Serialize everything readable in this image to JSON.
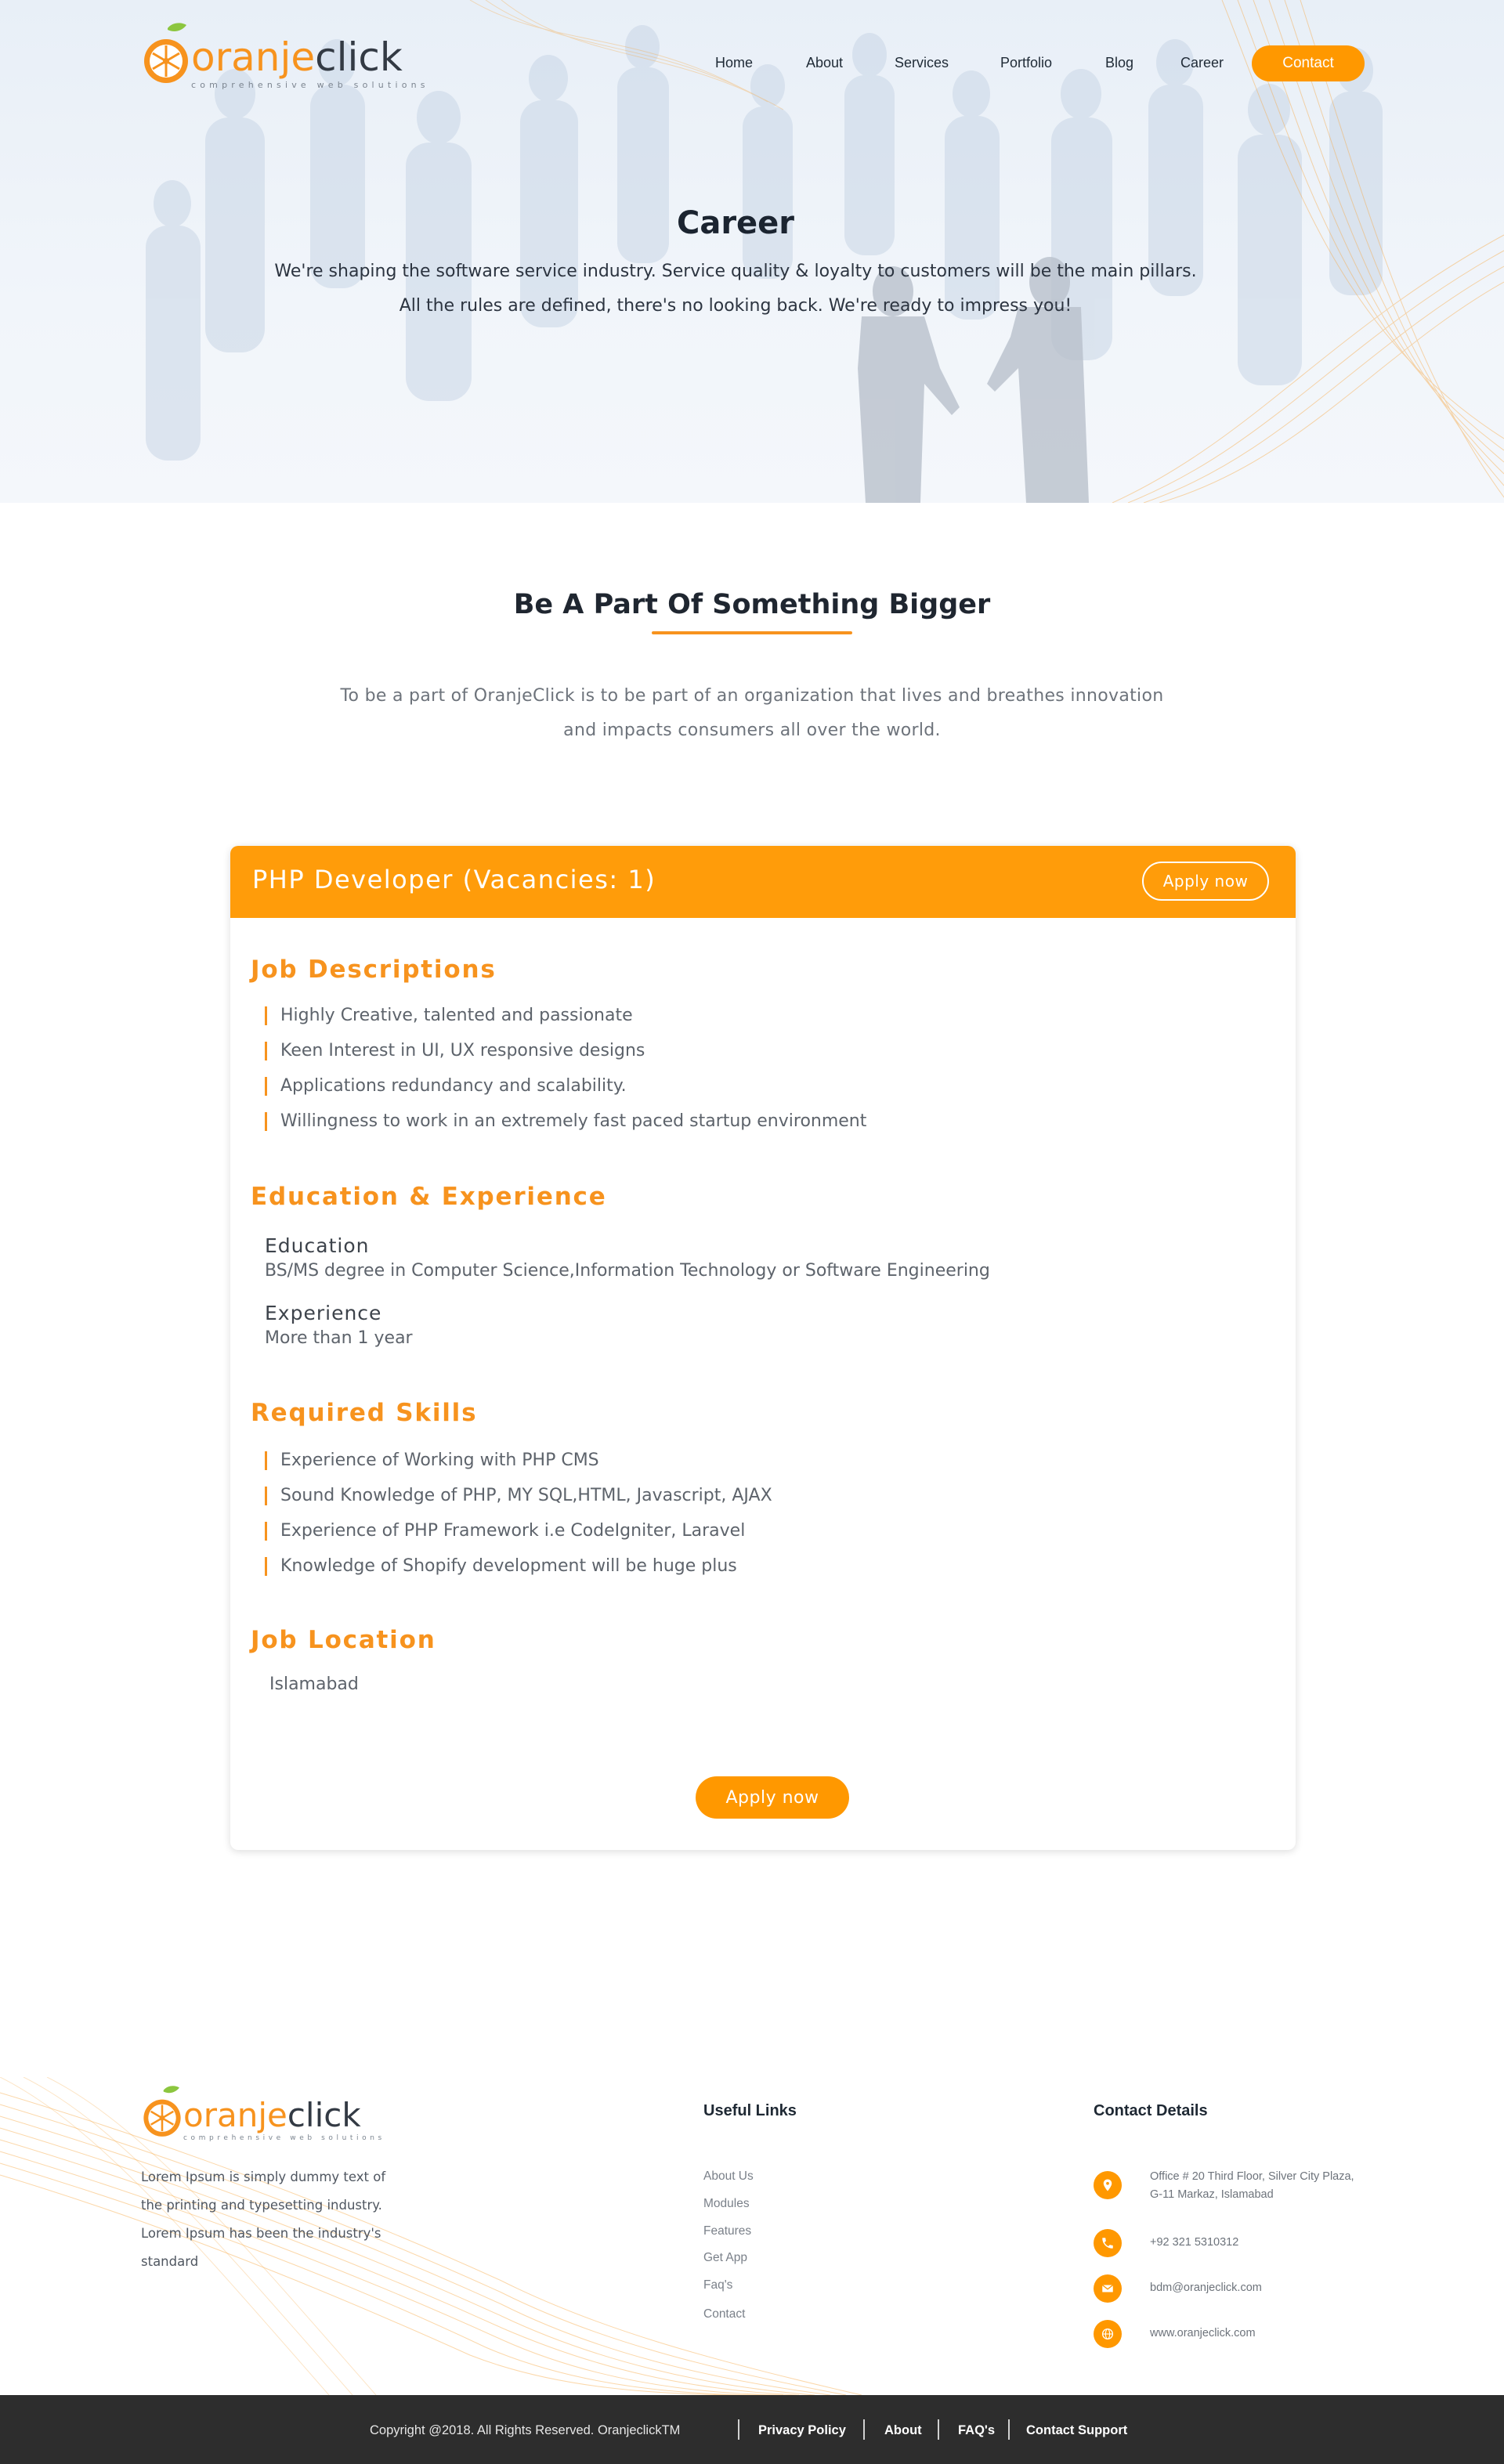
{
  "brand": {
    "wordmark_part1": "oranje",
    "wordmark_part2": "click",
    "tagline": "comprehensive web solutions",
    "accent_color": "#f7931e",
    "dark_text_color": "#333a44"
  },
  "nav": {
    "items": [
      {
        "label": "Home"
      },
      {
        "label": "About"
      },
      {
        "label": "Services"
      },
      {
        "label": "Portfolio"
      },
      {
        "label": "Blog"
      },
      {
        "label": "Career"
      }
    ],
    "cta_label": "Contact",
    "cta_color": "#ff9800"
  },
  "hero": {
    "title": "Career",
    "subtitle_line1": "We're shaping the software service industry. Service quality & loyalty to customers will be the main pillars.",
    "subtitle_line2": "All the rules are defined, there's no looking back. We're ready to impress you!"
  },
  "intro": {
    "title": "Be A Part Of Something Bigger",
    "text_line1": "To be a part of OranjeClick is to be part of an organization that lives and breathes innovation",
    "text_line2": "and impacts consumers all over the world."
  },
  "job": {
    "title": "PHP Developer (Vacancies: 1)",
    "apply_label": "Apply now",
    "header_color": "#ff9c0a",
    "descriptions_heading": "Job Descriptions",
    "descriptions": [
      "Highly Creative, talented and passionate",
      "Keen Interest in UI, UX responsive designs",
      "Applications redundancy and scalability.",
      "Willingness to work in an extremely fast paced startup environment"
    ],
    "education_heading": "Education & Experience",
    "education_label": "Education",
    "education_value": "BS/MS degree in Computer Science,Information Technology or Software Engineering",
    "experience_label": "Experience",
    "experience_value": "More than 1 year",
    "skills_heading": "Required Skills",
    "skills": [
      "Experience of Working with PHP CMS",
      "Sound Knowledge of PHP, MY SQL,HTML, Javascript, AJAX",
      "Experience of PHP Framework i.e CodeIgniter, Laravel",
      "Knowledge of Shopify development will be huge plus"
    ],
    "location_heading": "Job Location",
    "location_value": "Islamabad",
    "apply_bottom_label": "Apply now"
  },
  "footer": {
    "about_line1": "Lorem Ipsum is simply dummy text of",
    "about_line2": "the printing and typesetting industry.",
    "about_line3": "Lorem Ipsum has been the industry's",
    "about_line4": "standard",
    "useful_links_title": "Useful Links",
    "useful_links": [
      {
        "label": "About Us"
      },
      {
        "label": "Modules"
      },
      {
        "label": "Features"
      },
      {
        "label": "Get App"
      },
      {
        "label": "Faq's"
      },
      {
        "label": "Contact"
      }
    ],
    "contact_title": "Contact Details",
    "contact": {
      "address_line1": "Office # 20 Third Floor, Silver City Plaza,",
      "address_line2": "G-11 Markaz, Islamabad",
      "phone": "+92 321 5310312",
      "email": "bdm@oranjeclick.com",
      "website": "www.oranjeclick.com"
    },
    "icons": {
      "address": "location-pin-icon",
      "phone": "phone-icon",
      "email": "envelope-icon",
      "website": "globe-icon"
    }
  },
  "bottom_bar": {
    "copyright": "Copyright @2018. All Rights Reserved. OranjeclickTM",
    "links": [
      {
        "label": "Privacy Policy"
      },
      {
        "label": "About"
      },
      {
        "label": "FAQ's"
      },
      {
        "label": "Contact Support"
      }
    ],
    "background_color": "#2d2d2d"
  }
}
